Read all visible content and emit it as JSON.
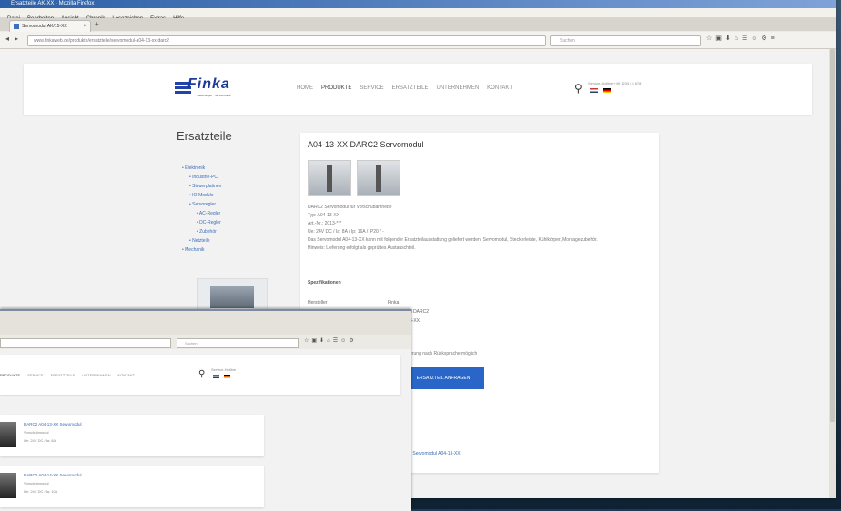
{
  "colors": {
    "accent": "#2a66c8",
    "link": "#3b6cb8",
    "brand": "#1c3a9c"
  },
  "browser": {
    "title": "Ersatzteile AK-XX · Mozilla Firefox",
    "menu": [
      "Datei",
      "Bearbeiten",
      "Ansicht",
      "Chronik",
      "Lesezeichen",
      "Extras",
      "Hilfe"
    ],
    "tab_title": "Servomodul AK/15-XX",
    "url": "www.finkaweb.de/produkte/ersatzteile/servomodul-a04-13-xx-darc2",
    "search_placeholder": "Suchen"
  },
  "site": {
    "logo": "Finka",
    "logo_tag": "Steuerungen · Servomodule",
    "nav": [
      "Home",
      "Produkte",
      "Service",
      "Ersatzteile",
      "Unternehmen",
      "Kontakt"
    ],
    "phone": "Service-Hotline +49 1234 / 5 678"
  },
  "sidebar": {
    "title": "Ersatzteile",
    "tree": [
      "• Elektronik",
      "• Industrie-PC",
      "• Steuerplatinen",
      "• IO-Module",
      "• Servoregler",
      "• AC-Regler",
      "• DC-Regler",
      "• Zubehör",
      "• Netzteile",
      "• Mechanik"
    ]
  },
  "product": {
    "title": "A04-13-XX DARC2 Servomodul",
    "desc": [
      "DARC2 Servomodul für Vorschubantriebe",
      "Typ: A04-13-XX",
      "Art.-Nr.: 2013-***",
      "Ue: 24V DC / Ia: 8A / Ip: 16A / IP20 / -",
      "Das Servomodul A04-13-XX kann mit folgender Ersatzteilausstattung geliefert werden: Servomodul, Steckerleiste, Kühlkörper, Montagezubehör.",
      "Hinweis: Lieferung erfolgt als geprüftes Austauschteil."
    ],
    "spec_heading": "Spezifikationen",
    "spec_label": "Hersteller",
    "spec_values": [
      "Finka",
      "Servomodul DARC2",
      "Typ: A04-13-XX"
    ],
    "cta_note": "Lieferung nach Rücksprache möglich",
    "cta": "ERSATZTEIL ANFRAGEN",
    "related": "Zum Servomodul A04-13-XX"
  },
  "window2": {
    "search_placeholder": "Suchen",
    "nav": [
      "Produkte",
      "Service",
      "Ersatzteile",
      "Unternehmen",
      "Kontakt"
    ],
    "phone": "Service-Hotline",
    "items": [
      {
        "title": "DARC2 A04-13-XX Servomodul",
        "line1": "Vorschubmodul",
        "line2": "Ue: 24V DC / Ia: 8A"
      },
      {
        "title": "DARC2 A04-14-XX Servomodul",
        "line1": "Vorschubmodul",
        "line2": "Ue: 24V DC / Ia: 10A"
      }
    ]
  }
}
